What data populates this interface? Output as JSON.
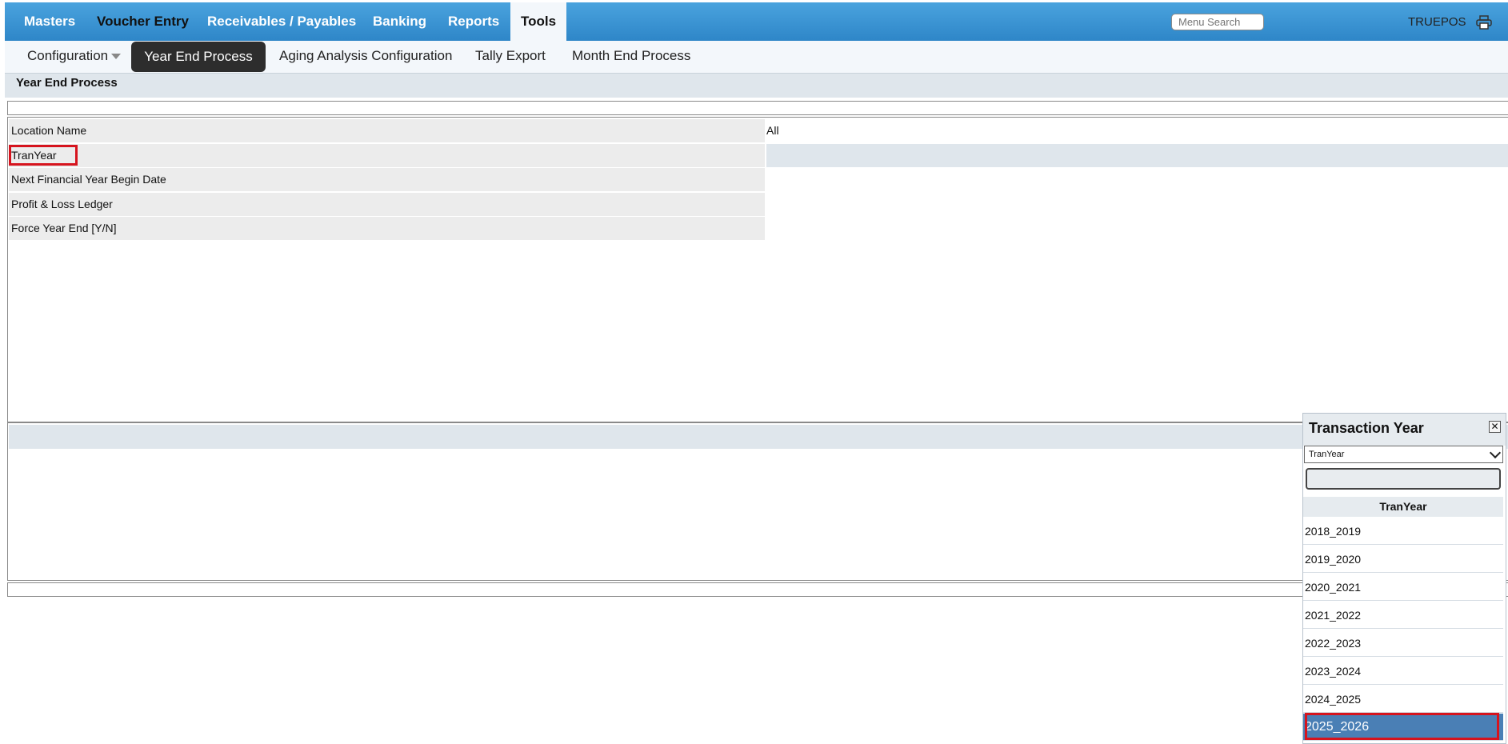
{
  "topnav": {
    "tabs": [
      {
        "label": "Masters"
      },
      {
        "label": "Voucher Entry"
      },
      {
        "label": "Receivables / Payables"
      },
      {
        "label": "Banking"
      },
      {
        "label": "Reports"
      },
      {
        "label": "Tools",
        "active": true
      }
    ],
    "search_placeholder": "Menu Search",
    "user": "TRUEPOS",
    "print_icon": "printer-icon"
  },
  "subnav": {
    "items": [
      {
        "label": "Configuration"
      },
      {
        "label": "Year End Process",
        "active": true
      },
      {
        "label": "Aging Analysis Configuration"
      },
      {
        "label": "Tally Export"
      },
      {
        "label": "Month End Process"
      }
    ]
  },
  "panel": {
    "title": "Year End Process",
    "fields": [
      {
        "label": "Location Name",
        "value": "All"
      },
      {
        "label": "TranYear",
        "value": ""
      },
      {
        "label": "Next Financial Year Begin Date",
        "value": ""
      },
      {
        "label": "Profit & Loss Ledger",
        "value": ""
      },
      {
        "label": "Force Year End [Y/N]",
        "value": ""
      }
    ]
  },
  "popup": {
    "title": "Transaction Year",
    "close_icon": "close-icon",
    "select_value": "TranYear",
    "search_value": "",
    "column_header": "TranYear",
    "items": [
      "2018_2019",
      "2019_2020",
      "2020_2021",
      "2021_2022",
      "2022_2023",
      "2023_2024",
      "2024_2025",
      "2025_2026"
    ],
    "selected": "2025_2026"
  },
  "colors": {
    "nav_blue": "#3a95d6",
    "highlight_red": "#d6141e",
    "selected_row": "#4a7fb5"
  }
}
